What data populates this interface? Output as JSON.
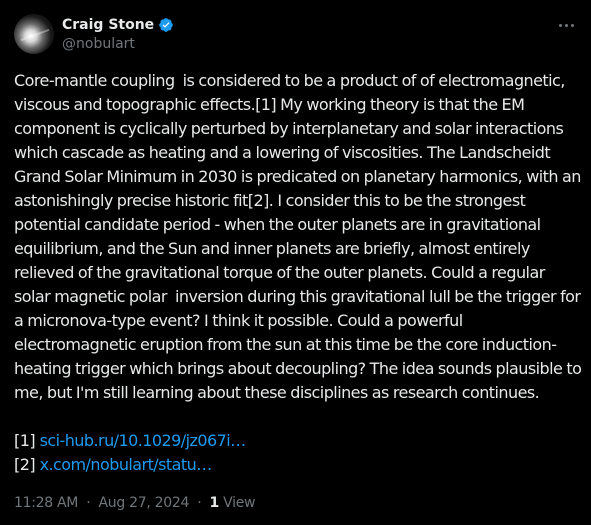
{
  "author": {
    "display_name": "Craig Stone",
    "handle": "@nobulart",
    "verified": true,
    "verified_color": "#1d9bf0"
  },
  "icons": {
    "avatar": "avatar-image",
    "verified": "verified-badge-icon",
    "more": "more-options-icon"
  },
  "post": {
    "text": "Core-mantle coupling  is considered to be a product of of electromagnetic, viscous and topographic effects.[1] My working theory is that the EM component is cyclically perturbed by interplanetary and solar interactions which cascade as heating and a lowering of viscosities. The Landscheidt Grand Solar Minimum in 2030 is predicated on planetary harmonics, with an astonishingly precise historic fit[2]. I consider this to be the strongest potential candidate period - when the outer planets are in gravitational equilibrium, and the Sun and inner planets are briefly, almost entirely relieved of the gravitational torque of the outer planets. Could a regular solar magnetic polar  inversion during this gravitational lull be the trigger for a micronova-type event? I think it possible. Could a powerful electromagnetic eruption from the sun at this time be the core induction-heating trigger which brings about decoupling? The idea sounds plausible to me, but I'm still learning about these disciplines as research continues.",
    "references": [
      {
        "marker": "[1]",
        "link_text": "sci-hub.ru/10.1029/jz067i…"
      },
      {
        "marker": "[2]",
        "link_text": "x.com/nobulart/statu…"
      }
    ],
    "link_color": "#1d9bf0"
  },
  "meta": {
    "time": "11:28 AM",
    "separator": "·",
    "date": "Aug 27, 2024",
    "views_count": "1",
    "views_label": "View"
  }
}
